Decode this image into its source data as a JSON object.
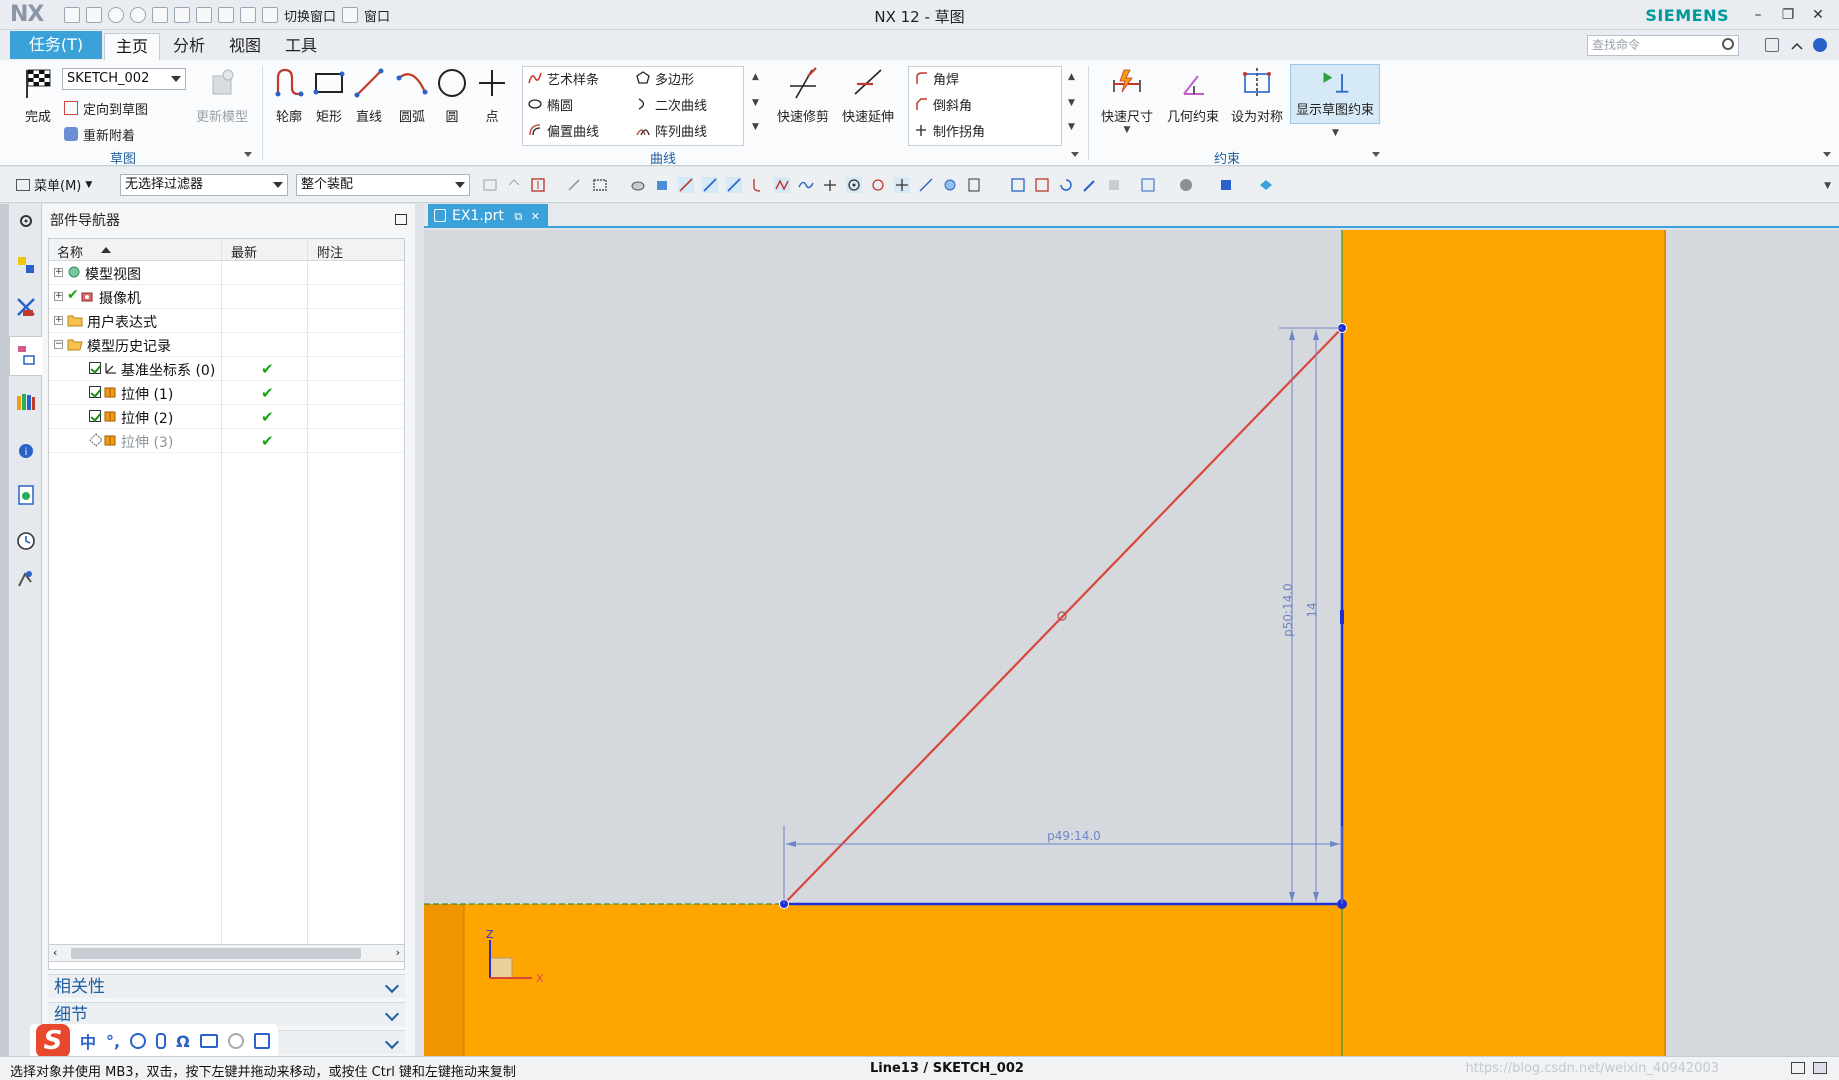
{
  "app": {
    "logo": "NX",
    "title": "NX 12 - 草图",
    "brand": "SIEMENS",
    "switch_window": "切换窗口",
    "window_menu": "窗口"
  },
  "tabs": {
    "task": "任务(T)",
    "items": [
      "主页",
      "分析",
      "视图",
      "工具"
    ],
    "active": "主页"
  },
  "search": {
    "placeholder": "查找命令"
  },
  "ribbon": {
    "sketch_group": {
      "finish": "完成",
      "sketch_name": "SKETCH_002",
      "orient": "定向到草图",
      "reattach": "重新附着",
      "update_model": "更新模型",
      "label": "草图"
    },
    "curve_group": {
      "profile": "轮廓",
      "rectangle": "矩形",
      "line": "直线",
      "arc": "圆弧",
      "circle": "圆",
      "point": "点",
      "studio_spline": "艺术样条",
      "polygon": "多边形",
      "ellipse": "椭圆",
      "conic": "二次曲线",
      "offset_curve": "偏置曲线",
      "pattern_curve": "阵列曲线",
      "quick_trim": "快速修剪",
      "quick_extend": "快速延伸",
      "fillet": "角焊",
      "chamfer": "倒斜角",
      "make_corner": "制作拐角",
      "label": "曲线"
    },
    "constraint_group": {
      "rapid_dimension": "快速尺寸",
      "geometric_constraints": "几何约束",
      "make_symmetric": "设为对称",
      "display_constraints": "显示草图约束",
      "label": "约束"
    }
  },
  "toolbar2": {
    "menu": "菜单(M)",
    "filter": "无选择过滤器",
    "scope": "整个装配"
  },
  "navigator": {
    "title": "部件导航器",
    "columns": [
      "名称",
      "最新",
      "附注"
    ],
    "rows": [
      {
        "label": "模型视图",
        "level": 0,
        "expander": "+",
        "status": ""
      },
      {
        "label": "摄像机",
        "level": 0,
        "expander": "+",
        "status": ""
      },
      {
        "label": "用户表达式",
        "level": 0,
        "expander": "+",
        "status": ""
      },
      {
        "label": "模型历史记录",
        "level": 0,
        "expander": "−",
        "status": ""
      },
      {
        "label": "基准坐标系 (0)",
        "level": 1,
        "expander": "",
        "status": "✔"
      },
      {
        "label": "拉伸 (1)",
        "level": 1,
        "expander": "",
        "status": "✔"
      },
      {
        "label": "拉伸 (2)",
        "level": 1,
        "expander": "",
        "status": "✔"
      },
      {
        "label": "拉伸 (3)",
        "level": 1,
        "expander": "",
        "status": "✔"
      }
    ],
    "sections": [
      "相关性",
      "细节",
      "预览"
    ]
  },
  "document": {
    "tab": "EX1.prt"
  },
  "sketch": {
    "dim_horizontal": "p49:14.0",
    "dim_vertical": "p50:14.0",
    "dim_vertical_inner": "14",
    "axis_z": "Z",
    "axis_x": "X"
  },
  "status": {
    "prompt": "选择对象并使用 MB3，双击，按下左键并拖动来移动，或按住 Ctrl 键和左键拖动来复制",
    "selection": "Line13 / SKETCH_002",
    "watermark": "https://blog.csdn.net/weixin_40942003"
  },
  "ime": {
    "mode": "中"
  },
  "colors": {
    "accent": "#3aa2d8",
    "orange_body": "#ffa500",
    "canvas_gray": "#d5d8dc",
    "sketch_line": "#d9473b",
    "constraint_blue": "#2233cc"
  }
}
